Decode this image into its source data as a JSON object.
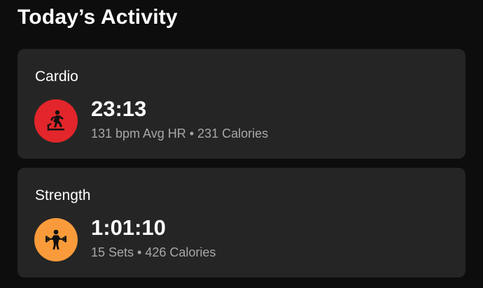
{
  "header": {
    "title": "Today’s Activity"
  },
  "activities": [
    {
      "title": "Cardio",
      "icon": "treadmill-runner-icon",
      "icon_color": "#e2262b",
      "duration": "23:13",
      "details": "131 bpm Avg HR • 231 Calories"
    },
    {
      "title": "Strength",
      "icon": "weightlifter-icon",
      "icon_color": "#f99b3a",
      "duration": "1:01:10",
      "details": "15 Sets • 426 Calories"
    }
  ]
}
